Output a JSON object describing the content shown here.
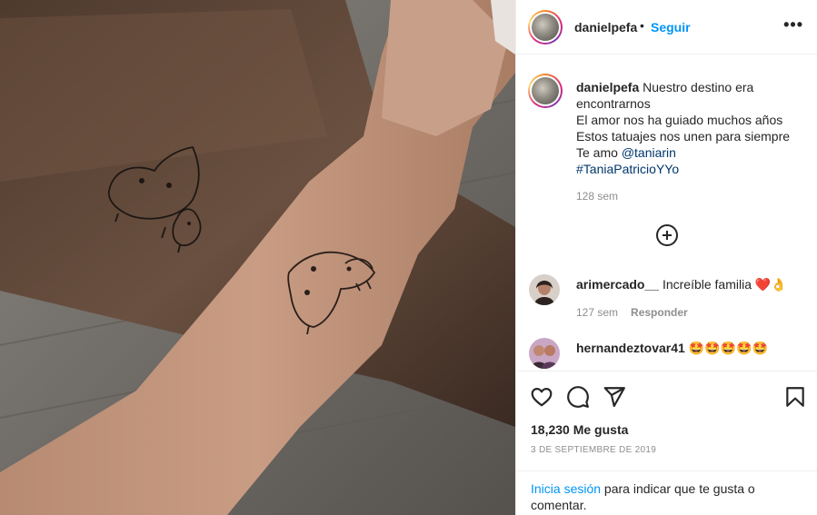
{
  "post": {
    "username": "danielpefa",
    "separator": "•",
    "follow_label": "Seguir",
    "more_icon": "more-options-icon",
    "more_label": "•••"
  },
  "caption": {
    "username": "danielpefa",
    "first_line": "Nuestro destino era",
    "lines": [
      "encontrarnos",
      "El amor nos ha guiado muchos años",
      "Estos tatuajes nos unen para siempre"
    ],
    "mention_prefix": "Te amo ",
    "mention": "@taniarin",
    "hashtag": "#TaniaPatricioYYo",
    "time": "128 sem"
  },
  "load_more_icon": "plus-circle-icon",
  "comments": [
    {
      "username": "arimercado__",
      "text": "Increíble familia",
      "emoji": "❤️👌",
      "time": "127 sem",
      "reply_label": "Responder"
    },
    {
      "username": "hernandeztovar41",
      "text": "",
      "emoji": "🤩🤩🤩🤩🤩"
    }
  ],
  "actions": {
    "like_icon": "heart-icon",
    "comment_icon": "comment-icon",
    "share_icon": "share-icon",
    "save_icon": "bookmark-icon"
  },
  "likes_text": "18,230 Me gusta",
  "date": "3 DE SEPTIEMBRE DE 2019",
  "login": {
    "link": "Inicia sesión",
    "text": " para indicar que te gusta o comentar."
  },
  "colors": {
    "accent": "#0095f6",
    "link": "#00376b",
    "muted": "#8e8e8e",
    "text": "#262626",
    "divider": "#efefef"
  }
}
